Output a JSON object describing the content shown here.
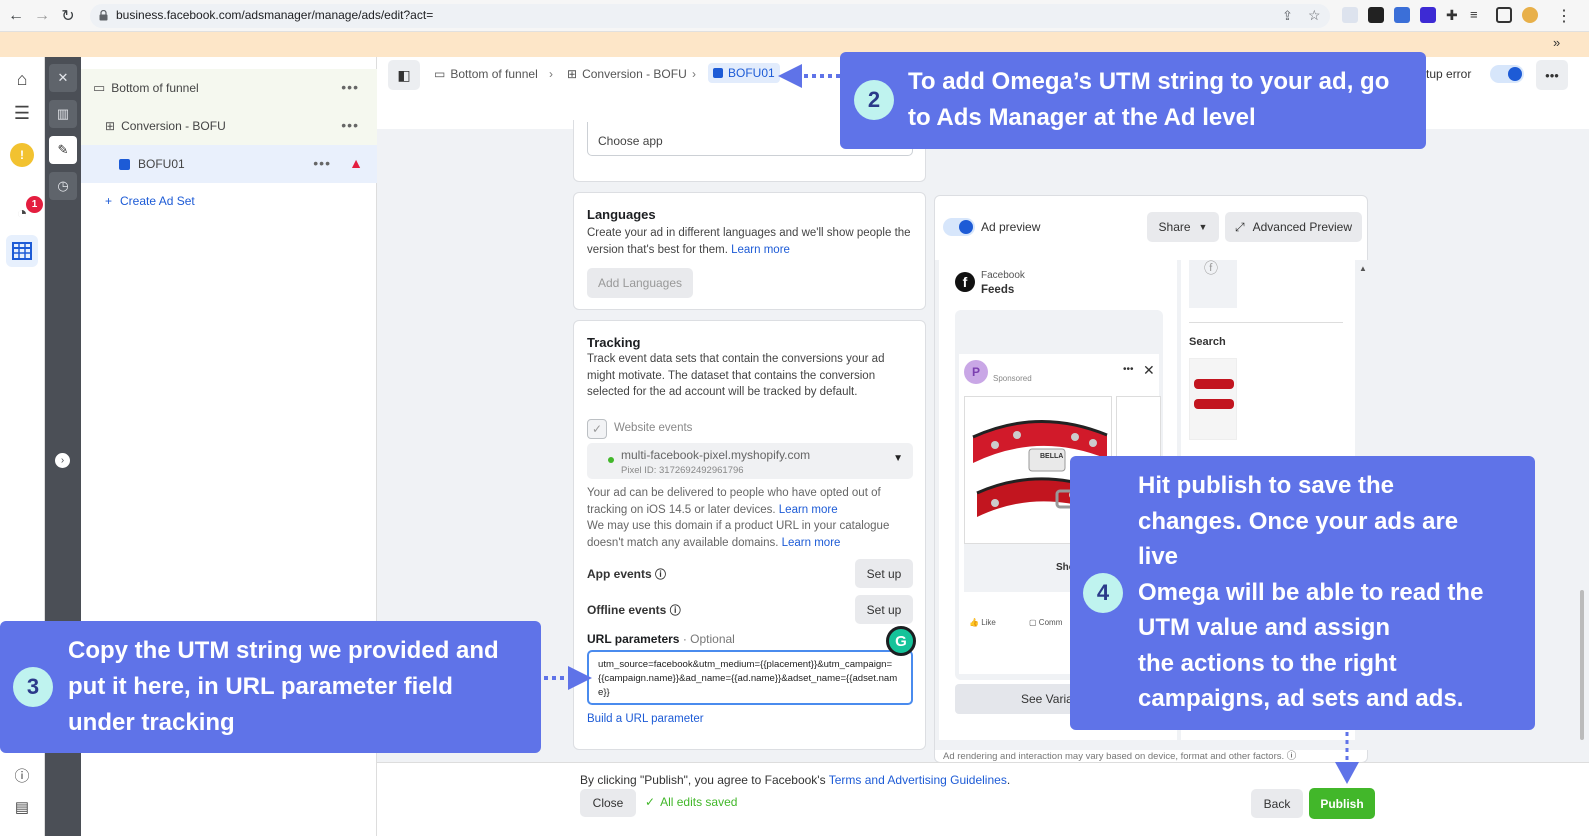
{
  "browser": {
    "url": "business.facebook.com/adsmanager/manage/ads/edit?act="
  },
  "rail": {
    "notification_count": "1"
  },
  "tree": {
    "campaign": "Bottom of funnel",
    "adset": "Conversion - BOFU",
    "ad": "BOFU01",
    "create": "Create Ad Set"
  },
  "header": {
    "crumb_campaign": "Bottom of funnel",
    "crumb_adset": "Conversion - BOFU",
    "crumb_ad": "BOFU01",
    "setup_error": "tup error"
  },
  "app_section": {
    "choose_app": "Choose app"
  },
  "languages": {
    "title": "Languages",
    "description": "Create your ad in different languages and we'll show people the version that's best for them.",
    "learn_more": "Learn more",
    "button": "Add Languages"
  },
  "tracking": {
    "title": "Tracking",
    "description": "Track event data sets that contain the conversions your ad might motivate. The dataset that contains the conversion selected for the ad account will be tracked by default.",
    "website_events": "Website events",
    "pixel_name": "multi-facebook-pixel.myshopify.com",
    "pixel_id": "Pixel ID: 3172692492961796",
    "ios_note": "Your ad can be delivered to people who have opted out of tracking on iOS 14.5 or later devices.",
    "ios_learn_more": "Learn more",
    "domain_note": "We may use this domain if a product URL in your catalogue doesn't match any available domains.",
    "domain_learn_more": "Learn more",
    "app_events": "App events",
    "offline_events": "Offline events",
    "setup_label": "Set up",
    "url_params_label": "URL parameters",
    "url_params_optional": " · Optional",
    "url_params_value": "utm_source=facebook&utm_medium={{placement}}&utm_campaign={{campaign.name}}&ad_name={{ad.name}}&adset_name={{adset.name}}",
    "build_link": "Build a URL parameter"
  },
  "preview": {
    "toggle_label": "Ad preview",
    "share": "Share",
    "advanced": "Advanced Preview",
    "platform": "Facebook",
    "placement": "Feeds",
    "search_label": "Search",
    "sponsored": "Sponsored",
    "shop_label": "Sho",
    "like": "Like",
    "comment": "Comm",
    "see_variations": "See Varia",
    "disclaimer": "Ad rendering and interaction may vary based on device, format and other factors.",
    "collar_tag": "BELLA"
  },
  "footer": {
    "agree_text": "By clicking \"Publish\", you agree to Facebook's",
    "terms_link": "Terms and Advertising Guidelines",
    "terms_end": ".",
    "close": "Close",
    "saved": "All edits saved",
    "back": "Back",
    "publish": "Publish"
  },
  "callouts": {
    "c2_num": "2",
    "c2_line1": "To add Omega’s UTM string to your ad, go",
    "c2_line2": "to Ads Manager at the Ad level",
    "c3_num": "3",
    "c3_line1": "Copy the UTM string we provided and",
    "c3_line2": "put it here, in URL parameter field",
    "c3_line3": "under tracking",
    "c4_num": "4",
    "c4_line1": "Hit publish to save the",
    "c4_line2": "changes. Once your ads are",
    "c4_line3": "live",
    "c4_line4": "Omega will be able to read the",
    "c4_line5": "UTM value and assign",
    "c4_line6": "the actions to the right",
    "c4_line7": "campaigns, ad sets and ads."
  },
  "colors": {
    "callout": "#5f73e8",
    "badge": "#bff3ef",
    "publish": "#42b72a",
    "link": "#1d5bd6"
  }
}
